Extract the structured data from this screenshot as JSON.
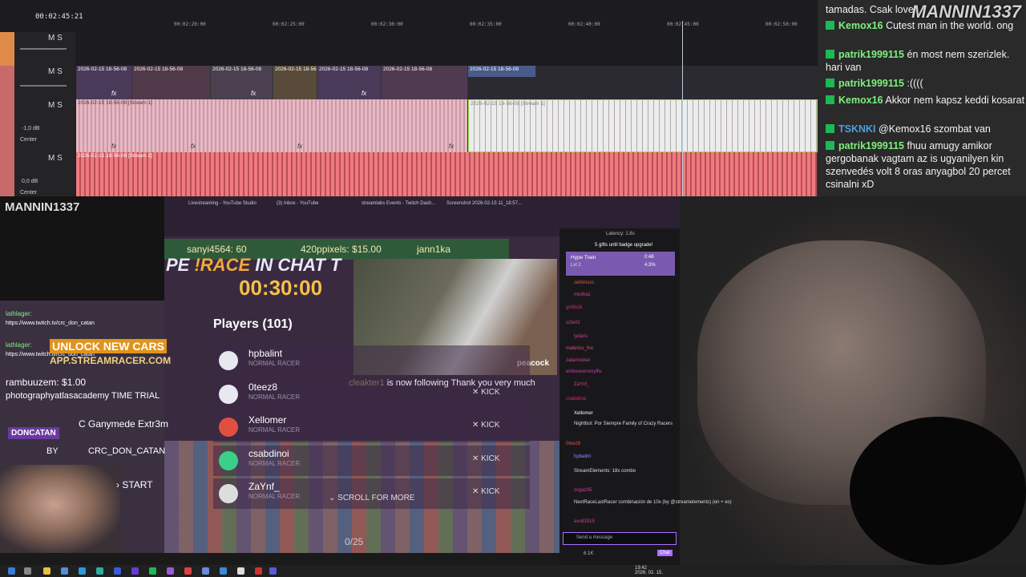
{
  "editor": {
    "timecode": "00:02:45:21",
    "ruler": [
      "00:02:20:00",
      "00:02:25:00",
      "00:02:30:00",
      "00:02:35:00",
      "00:02:40:00",
      "00:02:45:00",
      "00:02:50:00"
    ],
    "ms_label": "M S",
    "tracks": [
      {
        "db": "",
        "center": ""
      },
      {
        "db": "",
        "center": ""
      },
      {
        "db": "-1,0 dB",
        "center": "Center"
      },
      {
        "db": "0,0 dB",
        "center": "Center"
      }
    ],
    "clip_label": "2026-02-15 18-56-08",
    "clip_label_stream1": "2026-02-15 18-56-08 [Stream 1]",
    "clip_label_stream2": "2026-02-15 18-56-08 [Stream 2]",
    "fx": "fx"
  },
  "top_chat": {
    "brand": "MANNIN1337",
    "lines": [
      {
        "user": "",
        "text": "tamadas. Csak love"
      },
      {
        "user": "Kemox16",
        "text": "Cutest man in the world. ong"
      },
      {
        "user": "patrik1999115",
        "text": "én most nem szerizlek. hari van"
      },
      {
        "user": "patrik1999115",
        "text": ":(((("
      },
      {
        "user": "Kemox16",
        "text": "Akkor nem kapsz keddi kosarat"
      },
      {
        "user": "TSKNKI",
        "text": "@Kemox16 szombat van"
      },
      {
        "user": "patrik1999115",
        "text": "fhuu amugy amikor gergobanak vagtam az is ugyanilyen kin szenvedés volt 8 oras anyagbol 20 percet csinalni xD"
      }
    ]
  },
  "cam1": {
    "brand": "MANNIN1337"
  },
  "browser": {
    "tabs": [
      "Livestreaming - YouTube Studio",
      "(3) Inbox - YouTube",
      "streamlabs Events - Twitch Dash...",
      "Screenshot 2026-02-15 11_18:57..."
    ]
  },
  "alerts": {
    "a1": "sanyi4564: 60",
    "a2": "420ppixels: $15.00",
    "a3": "jann1ka"
  },
  "race": {
    "banner_pre": "PE ",
    "banner_hl": "!RACE",
    "banner_post": " IN CHAT T",
    "timer": "00:30:00",
    "peacock": "peacock",
    "players_title": "Players (101)",
    "players": [
      {
        "name": "hpbalint",
        "sub": "NORMAL RACER",
        "kick": "✕ KICK"
      },
      {
        "name": "0teez8",
        "sub": "NORMAL RACER",
        "kick": "✕ KICK"
      },
      {
        "name": "Xellomer",
        "sub": "NORMAL RACER",
        "kick": "✕ KICK"
      },
      {
        "name": "csabdinoi",
        "sub": "NORMAL RACER",
        "kick": "✕ KICK"
      },
      {
        "name": "ZaYnf_",
        "sub": "NORMAL RACER",
        "kick": "✕ KICK"
      }
    ],
    "scroll_more": "⌄ SCROLL FOR MORE",
    "follow_user": "cleakter1",
    "follow_text": " is now following Thank you very much",
    "progress": "0/25"
  },
  "left_overlay": {
    "chat1_user": "lathlager:",
    "chat1_text": "https://www.twitch.tv/crc_don_catan",
    "chat2_user": "lathlager:",
    "chat2_text": "https://www.twitch.tv/crc_don_catan",
    "unlock": "UNLOCK NEW CARS",
    "app_url": "APP.STREAMRACER.COM",
    "donation": "rambuuzem: $1.00",
    "mode": "photographyatlasacademy TIME TRIAL",
    "car": "C Ganymede Extr3m",
    "doncatan": "DONCATAN",
    "by": "BY",
    "by_name": "CRC_DON_CATAN",
    "start": "› START"
  },
  "twitch": {
    "latency": "Latency: 1.8s",
    "badge_upgrade": "5 gifts until badge upgrade!",
    "hype_title": "Hype Train",
    "hype_level": "Lvl 2",
    "hype_time": "0:48",
    "hype_pct": "4.3%",
    "chatters": [
      "sebimuss",
      "mlolhaz",
      "gottik2k",
      "sztertz",
      "lydaris",
      "materics_fox",
      "zalamvokel",
      "elnbeaversmyflls",
      "ZaYnf_",
      "csabdinoi",
      "Xellomer",
      "Nightbot: Por Siempre Family of Crazy Racers",
      "0teez8",
      "hpbalint",
      "StreamElements: 18x combo",
      "zxgaz05",
      "NextRaceLastRacer combinación de 10x (by @streamelements) (en + es)",
      "avoll3315"
    ],
    "send": "Send a message",
    "chat_btn": "Chat",
    "points": "6.1K"
  },
  "taskbar": {
    "time": "19:42",
    "date": "2026. 02. 15."
  },
  "colors": {
    "audio_track": "#e8767a",
    "video_track": "#5a4a6a",
    "chat_user": "#7ef07e",
    "twitch_purple": "#a970ff"
  }
}
